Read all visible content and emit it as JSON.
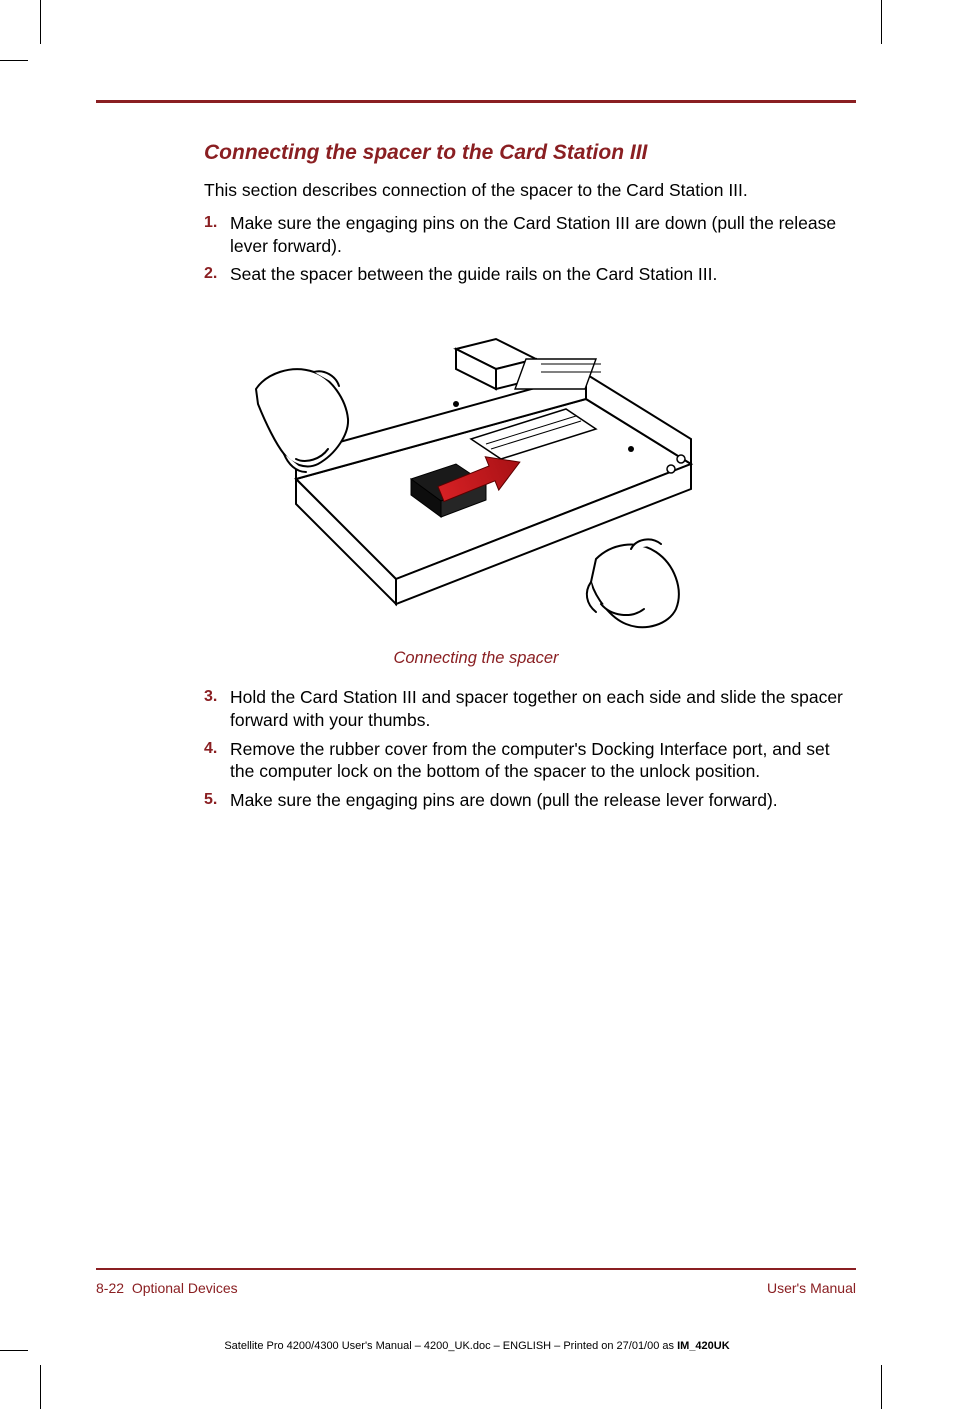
{
  "section": {
    "title": "Connecting the spacer to the Card Station III",
    "intro": "This section describes connection of the spacer to the Card Station III.",
    "steps_top": [
      {
        "num": "1.",
        "text": "Make sure the engaging pins on the Card Station III are down (pull the release lever forward)."
      },
      {
        "num": "2.",
        "text": "Seat the spacer between the guide rails on the Card Station III."
      }
    ],
    "figure_caption": "Connecting the spacer",
    "steps_bottom": [
      {
        "num": "3.",
        "text": "Hold the Card Station III and spacer together on each side and slide the spacer forward with your thumbs."
      },
      {
        "num": "4.",
        "text": "Remove the rubber cover from the computer's Docking Interface port, and set the computer lock on the bottom of the spacer to the unlock position."
      },
      {
        "num": "5.",
        "text": "Make sure the engaging pins are down (pull the release lever forward)."
      }
    ]
  },
  "footer": {
    "page_ref": "8-22",
    "chapter": "Optional Devices",
    "right": "User's Manual"
  },
  "imprint": {
    "prefix": "Satellite Pro 4200/4300 User's Manual  – 4200_UK.doc – ENGLISH – Printed on 27/01/00 as ",
    "code": "IM_420UK"
  }
}
